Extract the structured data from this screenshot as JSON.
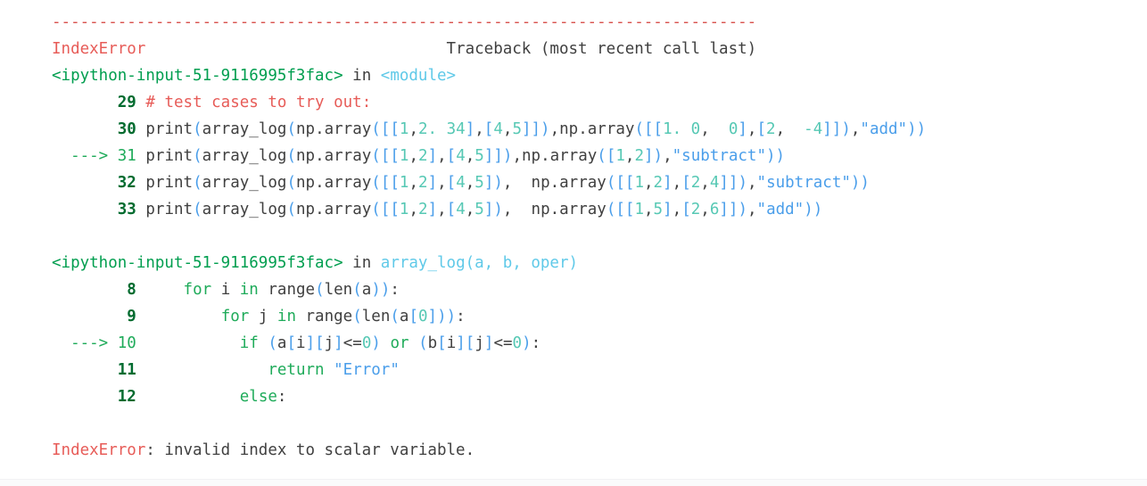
{
  "output": {
    "kind": "ipython-traceback",
    "exception_type": "IndexError",
    "exception_message": "invalid index to scalar variable.",
    "traceback_header_text": "Traceback (most recent call last)",
    "separator": "---------------------------------------------------------------------------",
    "colors": {
      "background": "#ffffff",
      "text": "#404040",
      "error": "#e75c58",
      "separator": "#d9534f",
      "filename": "#009e4f",
      "function": "#5fc9e8",
      "lineno": "#006b2f",
      "lineno_current": "#1fab5a",
      "arrow": "#1fab5a",
      "keyword": "#1fab5a",
      "string": "#4a9eea",
      "paren": "#4a9eea",
      "number": "#56c8b4",
      "comment": "#e75c58"
    },
    "frames": [
      {
        "file": "<ipython-input-51-9116995f3fac>",
        "in_word": "in",
        "scope": "<module>",
        "current_line": 31,
        "lines": [
          {
            "number": "29",
            "arrow": "",
            "current": false,
            "tokens": [
              {
                "t": "comment",
                "v": "# test cases to try out:"
              }
            ]
          },
          {
            "number": "30",
            "arrow": "",
            "current": false,
            "tokens": [
              {
                "t": "name",
                "v": "print"
              },
              {
                "t": "paren",
                "v": "("
              },
              {
                "t": "name",
                "v": "array_log"
              },
              {
                "t": "paren",
                "v": "("
              },
              {
                "t": "name",
                "v": "np."
              },
              {
                "t": "name",
                "v": "array"
              },
              {
                "t": "paren",
                "v": "(["
              },
              {
                "t": "paren",
                "v": "["
              },
              {
                "t": "num",
                "v": "1"
              },
              {
                "t": "op",
                "v": ","
              },
              {
                "t": "num",
                "v": "2. 34"
              },
              {
                "t": "paren",
                "v": "]"
              },
              {
                "t": "op",
                "v": ","
              },
              {
                "t": "paren",
                "v": "["
              },
              {
                "t": "num",
                "v": "4"
              },
              {
                "t": "op",
                "v": ","
              },
              {
                "t": "num",
                "v": "5"
              },
              {
                "t": "paren",
                "v": "]])"
              },
              {
                "t": "op",
                "v": ","
              },
              {
                "t": "name",
                "v": "np."
              },
              {
                "t": "name",
                "v": "array"
              },
              {
                "t": "paren",
                "v": "(["
              },
              {
                "t": "paren",
                "v": "["
              },
              {
                "t": "num",
                "v": "1. 0"
              },
              {
                "t": "op",
                "v": ", "
              },
              {
                "t": "num",
                "v": " 0"
              },
              {
                "t": "paren",
                "v": "]"
              },
              {
                "t": "op",
                "v": ","
              },
              {
                "t": "paren",
                "v": "["
              },
              {
                "t": "num",
                "v": "2"
              },
              {
                "t": "op",
                "v": ", "
              },
              {
                "t": "num",
                "v": " -4"
              },
              {
                "t": "paren",
                "v": "]])"
              },
              {
                "t": "op",
                "v": ","
              },
              {
                "t": "str",
                "v": "\"add\""
              },
              {
                "t": "paren",
                "v": "))"
              }
            ]
          },
          {
            "number": "31",
            "arrow": "---> ",
            "current": true,
            "tokens": [
              {
                "t": "name",
                "v": "print"
              },
              {
                "t": "paren",
                "v": "("
              },
              {
                "t": "name",
                "v": "array_log"
              },
              {
                "t": "paren",
                "v": "("
              },
              {
                "t": "name",
                "v": "np."
              },
              {
                "t": "name",
                "v": "array"
              },
              {
                "t": "paren",
                "v": "(["
              },
              {
                "t": "paren",
                "v": "["
              },
              {
                "t": "num",
                "v": "1"
              },
              {
                "t": "op",
                "v": ","
              },
              {
                "t": "num",
                "v": "2"
              },
              {
                "t": "paren",
                "v": "]"
              },
              {
                "t": "op",
                "v": ","
              },
              {
                "t": "paren",
                "v": "["
              },
              {
                "t": "num",
                "v": "4"
              },
              {
                "t": "op",
                "v": ","
              },
              {
                "t": "num",
                "v": "5"
              },
              {
                "t": "paren",
                "v": "]])"
              },
              {
                "t": "op",
                "v": ","
              },
              {
                "t": "name",
                "v": "np."
              },
              {
                "t": "name",
                "v": "array"
              },
              {
                "t": "paren",
                "v": "(["
              },
              {
                "t": "num",
                "v": "1"
              },
              {
                "t": "op",
                "v": ","
              },
              {
                "t": "num",
                "v": "2"
              },
              {
                "t": "paren",
                "v": "])"
              },
              {
                "t": "op",
                "v": ","
              },
              {
                "t": "str",
                "v": "\"subtract\""
              },
              {
                "t": "paren",
                "v": "))"
              }
            ]
          },
          {
            "number": "32",
            "arrow": "",
            "current": false,
            "tokens": [
              {
                "t": "name",
                "v": "print"
              },
              {
                "t": "paren",
                "v": "("
              },
              {
                "t": "name",
                "v": "array_log"
              },
              {
                "t": "paren",
                "v": "("
              },
              {
                "t": "name",
                "v": "np."
              },
              {
                "t": "name",
                "v": "array"
              },
              {
                "t": "paren",
                "v": "(["
              },
              {
                "t": "paren",
                "v": "["
              },
              {
                "t": "num",
                "v": "1"
              },
              {
                "t": "op",
                "v": ","
              },
              {
                "t": "num",
                "v": "2"
              },
              {
                "t": "paren",
                "v": "]"
              },
              {
                "t": "op",
                "v": ","
              },
              {
                "t": "paren",
                "v": "["
              },
              {
                "t": "num",
                "v": "4"
              },
              {
                "t": "op",
                "v": ","
              },
              {
                "t": "num",
                "v": "5"
              },
              {
                "t": "paren",
                "v": "])"
              },
              {
                "t": "op",
                "v": ",  "
              },
              {
                "t": "name",
                "v": "np."
              },
              {
                "t": "name",
                "v": "array"
              },
              {
                "t": "paren",
                "v": "(["
              },
              {
                "t": "paren",
                "v": "["
              },
              {
                "t": "num",
                "v": "1"
              },
              {
                "t": "op",
                "v": ","
              },
              {
                "t": "num",
                "v": "2"
              },
              {
                "t": "paren",
                "v": "]"
              },
              {
                "t": "op",
                "v": ","
              },
              {
                "t": "paren",
                "v": "["
              },
              {
                "t": "num",
                "v": "2"
              },
              {
                "t": "op",
                "v": ","
              },
              {
                "t": "num",
                "v": "4"
              },
              {
                "t": "paren",
                "v": "]])"
              },
              {
                "t": "op",
                "v": ","
              },
              {
                "t": "str",
                "v": "\"subtract\""
              },
              {
                "t": "paren",
                "v": "))"
              }
            ]
          },
          {
            "number": "33",
            "arrow": "",
            "current": false,
            "tokens": [
              {
                "t": "name",
                "v": "print"
              },
              {
                "t": "paren",
                "v": "("
              },
              {
                "t": "name",
                "v": "array_log"
              },
              {
                "t": "paren",
                "v": "("
              },
              {
                "t": "name",
                "v": "np."
              },
              {
                "t": "name",
                "v": "array"
              },
              {
                "t": "paren",
                "v": "(["
              },
              {
                "t": "paren",
                "v": "["
              },
              {
                "t": "num",
                "v": "1"
              },
              {
                "t": "op",
                "v": ","
              },
              {
                "t": "num",
                "v": "2"
              },
              {
                "t": "paren",
                "v": "]"
              },
              {
                "t": "op",
                "v": ","
              },
              {
                "t": "paren",
                "v": "["
              },
              {
                "t": "num",
                "v": "4"
              },
              {
                "t": "op",
                "v": ","
              },
              {
                "t": "num",
                "v": "5"
              },
              {
                "t": "paren",
                "v": "])"
              },
              {
                "t": "op",
                "v": ",  "
              },
              {
                "t": "name",
                "v": "np."
              },
              {
                "t": "name",
                "v": "array"
              },
              {
                "t": "paren",
                "v": "(["
              },
              {
                "t": "paren",
                "v": "["
              },
              {
                "t": "num",
                "v": "1"
              },
              {
                "t": "op",
                "v": ","
              },
              {
                "t": "num",
                "v": "5"
              },
              {
                "t": "paren",
                "v": "]"
              },
              {
                "t": "op",
                "v": ","
              },
              {
                "t": "paren",
                "v": "["
              },
              {
                "t": "num",
                "v": "2"
              },
              {
                "t": "op",
                "v": ","
              },
              {
                "t": "num",
                "v": "6"
              },
              {
                "t": "paren",
                "v": "]])"
              },
              {
                "t": "op",
                "v": ","
              },
              {
                "t": "str",
                "v": "\"add\""
              },
              {
                "t": "paren",
                "v": "))"
              }
            ]
          }
        ]
      },
      {
        "file": "<ipython-input-51-9116995f3fac>",
        "in_word": "in",
        "scope": "array_log(a, b, oper)",
        "current_line": 10,
        "lines": [
          {
            "number": " 8",
            "arrow": "",
            "current": false,
            "indent": 4,
            "tokens": [
              {
                "t": "kw",
                "v": "for"
              },
              {
                "t": "plain",
                "v": " i "
              },
              {
                "t": "kw",
                "v": "in"
              },
              {
                "t": "plain",
                "v": " range"
              },
              {
                "t": "paren",
                "v": "("
              },
              {
                "t": "plain",
                "v": "len"
              },
              {
                "t": "paren",
                "v": "("
              },
              {
                "t": "plain",
                "v": "a"
              },
              {
                "t": "paren",
                "v": "))"
              },
              {
                "t": "op",
                "v": ":"
              }
            ]
          },
          {
            "number": " 9",
            "arrow": "",
            "current": false,
            "indent": 8,
            "tokens": [
              {
                "t": "kw",
                "v": "for"
              },
              {
                "t": "plain",
                "v": " j "
              },
              {
                "t": "kw",
                "v": "in"
              },
              {
                "t": "plain",
                "v": " range"
              },
              {
                "t": "paren",
                "v": "("
              },
              {
                "t": "plain",
                "v": "len"
              },
              {
                "t": "paren",
                "v": "("
              },
              {
                "t": "plain",
                "v": "a"
              },
              {
                "t": "paren",
                "v": "["
              },
              {
                "t": "num",
                "v": "0"
              },
              {
                "t": "paren",
                "v": "]))"
              },
              {
                "t": "op",
                "v": ":"
              }
            ]
          },
          {
            "number": "10",
            "arrow": "---> ",
            "current": true,
            "indent": 10,
            "tokens": [
              {
                "t": "kw",
                "v": "if"
              },
              {
                "t": "plain",
                "v": " "
              },
              {
                "t": "paren",
                "v": "("
              },
              {
                "t": "plain",
                "v": "a"
              },
              {
                "t": "paren",
                "v": "["
              },
              {
                "t": "plain",
                "v": "i"
              },
              {
                "t": "paren",
                "v": "]["
              },
              {
                "t": "plain",
                "v": "j"
              },
              {
                "t": "paren",
                "v": "]"
              },
              {
                "t": "op",
                "v": "<="
              },
              {
                "t": "num",
                "v": "0"
              },
              {
                "t": "paren",
                "v": ")"
              },
              {
                "t": "plain",
                "v": " "
              },
              {
                "t": "kw",
                "v": "or"
              },
              {
                "t": "plain",
                "v": " "
              },
              {
                "t": "paren",
                "v": "("
              },
              {
                "t": "plain",
                "v": "b"
              },
              {
                "t": "paren",
                "v": "["
              },
              {
                "t": "plain",
                "v": "i"
              },
              {
                "t": "paren",
                "v": "]["
              },
              {
                "t": "plain",
                "v": "j"
              },
              {
                "t": "paren",
                "v": "]"
              },
              {
                "t": "op",
                "v": "<="
              },
              {
                "t": "num",
                "v": "0"
              },
              {
                "t": "paren",
                "v": ")"
              },
              {
                "t": "op",
                "v": ":"
              }
            ]
          },
          {
            "number": "11",
            "arrow": "",
            "current": false,
            "indent": 13,
            "tokens": [
              {
                "t": "kw",
                "v": "return"
              },
              {
                "t": "plain",
                "v": " "
              },
              {
                "t": "str",
                "v": "\"Error\""
              }
            ]
          },
          {
            "number": "12",
            "arrow": "",
            "current": false,
            "indent": 10,
            "tokens": [
              {
                "t": "kw",
                "v": "else"
              },
              {
                "t": "op",
                "v": ":"
              }
            ]
          }
        ]
      }
    ]
  }
}
